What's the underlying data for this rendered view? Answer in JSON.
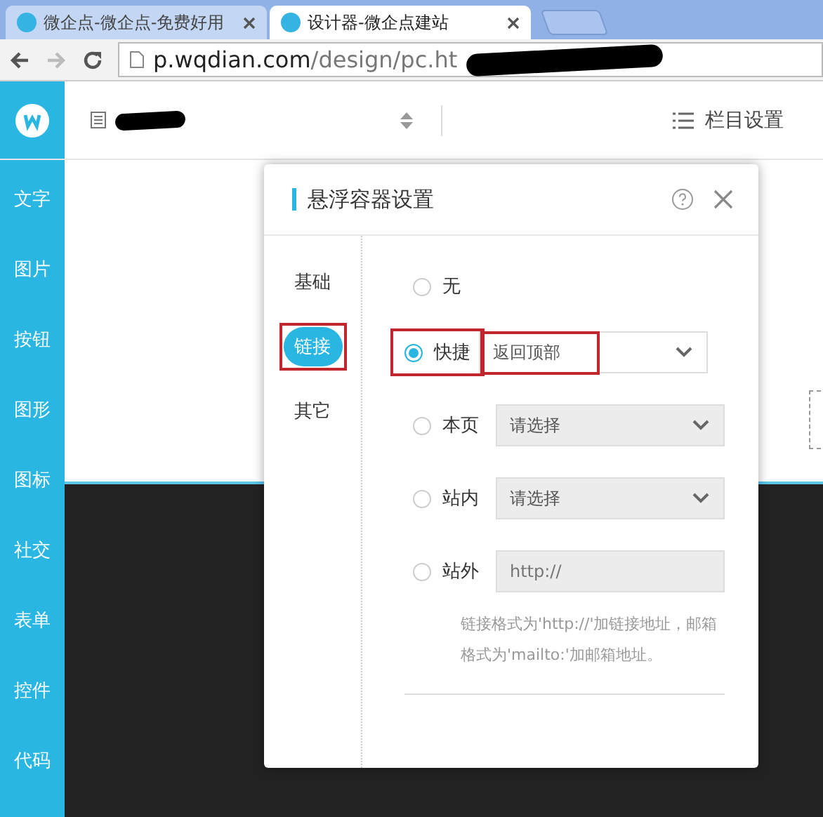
{
  "browser": {
    "tabs": [
      {
        "title": "微企点-微企点-免费好用",
        "selected": false
      },
      {
        "title": "设计器-微企点建站",
        "selected": true
      }
    ],
    "url": {
      "host": "p.wqdian.com",
      "path": "/design/pc.ht"
    }
  },
  "sidebar": {
    "items": [
      "文字",
      "图片",
      "按钮",
      "图形",
      "图标",
      "社交",
      "表单",
      "控件",
      "代码"
    ]
  },
  "header": {
    "column_settings": "栏目设置"
  },
  "dialog": {
    "title": "悬浮容器设置",
    "tabs": [
      {
        "label": "基础",
        "selected": false,
        "highlighted": false
      },
      {
        "label": "链接",
        "selected": true,
        "highlighted": true
      },
      {
        "label": "其它",
        "selected": false,
        "highlighted": false
      }
    ],
    "options": [
      {
        "kind": "none",
        "label": "无",
        "selected": false,
        "highlighted": false
      },
      {
        "kind": "select",
        "label": "快捷",
        "selected": true,
        "highlighted": true,
        "value": "返回顶部",
        "value_highlighted": true,
        "disabled": false
      },
      {
        "kind": "select",
        "label": "本页",
        "selected": false,
        "highlighted": false,
        "value": "请选择",
        "value_highlighted": false,
        "disabled": true
      },
      {
        "kind": "select",
        "label": "站内",
        "selected": false,
        "highlighted": false,
        "value": "请选择",
        "value_highlighted": false,
        "disabled": true
      },
      {
        "kind": "input",
        "label": "站外",
        "selected": false,
        "highlighted": false,
        "placeholder": "http://",
        "disabled": true
      }
    ],
    "hint": "链接格式为'http://'加链接地址，邮箱格式为'mailto:'加邮箱地址。"
  }
}
